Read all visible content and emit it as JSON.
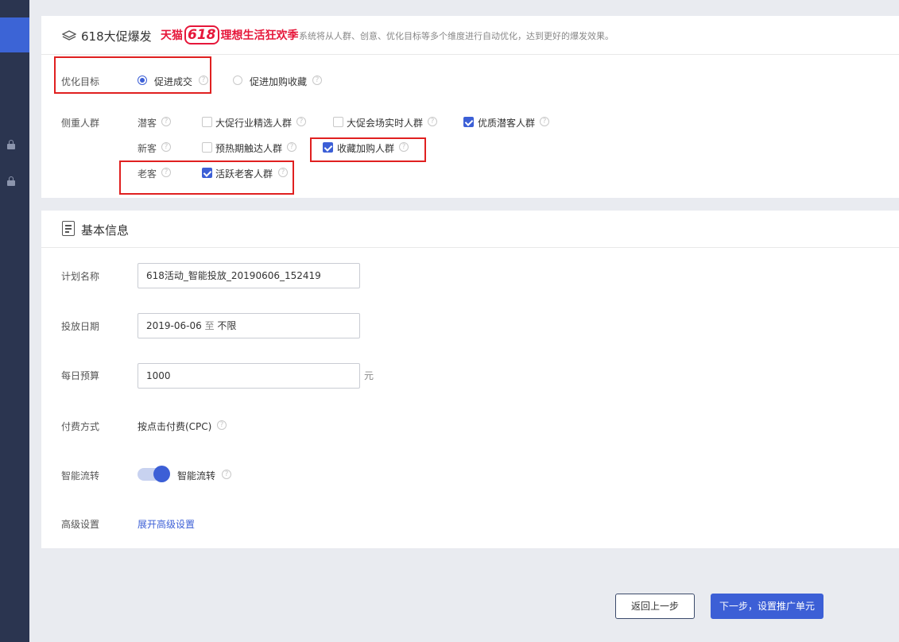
{
  "campaign": {
    "title": "618大促爆发",
    "tmall_brand": "天猫",
    "tmall_num": "618",
    "tmall_slogan": "理想生活狂欢季",
    "description": "系统将从人群、创意、优化目标等多个维度进行自动优化，达到更好的爆发效果。"
  },
  "optimize": {
    "label": "优化目标",
    "options": [
      {
        "label": "促进成交",
        "selected": true
      },
      {
        "label": "促进加购收藏",
        "selected": false
      }
    ]
  },
  "audience": {
    "label": "侧重人群",
    "groups": [
      {
        "name": "潜客",
        "items": [
          {
            "label": "大促行业精选人群",
            "checked": false
          },
          {
            "label": "大促会场实时人群",
            "checked": false
          },
          {
            "label": "优质潜客人群",
            "checked": true
          }
        ]
      },
      {
        "name": "新客",
        "items": [
          {
            "label": "预热期触达人群",
            "checked": false
          },
          {
            "label": "收藏加购人群",
            "checked": true
          }
        ]
      },
      {
        "name": "老客",
        "items": [
          {
            "label": "活跃老客人群",
            "checked": true
          }
        ]
      }
    ]
  },
  "basic": {
    "title": "基本信息",
    "plan_name_label": "计划名称",
    "plan_name_value": "618活动_智能投放_20190606_152419",
    "date_label": "投放日期",
    "date_start": "2019-06-06",
    "date_sep": "至",
    "date_end": "不限",
    "budget_label": "每日预算",
    "budget_value": "1000",
    "budget_unit": "元",
    "pay_label": "付费方式",
    "pay_value": "按点击付费(CPC)",
    "smart_label": "智能流转",
    "smart_toggle_label": "智能流转",
    "smart_on": true,
    "advanced_label": "高级设置",
    "advanced_link": "展开高级设置"
  },
  "footer": {
    "back_label": "返回上一步",
    "next_label": "下一步，设置推广单元"
  },
  "colors": {
    "primary": "#3c5fd6",
    "sidebar": "#2b3550",
    "highlight": "#e02020",
    "tmall": "#e6173a"
  }
}
